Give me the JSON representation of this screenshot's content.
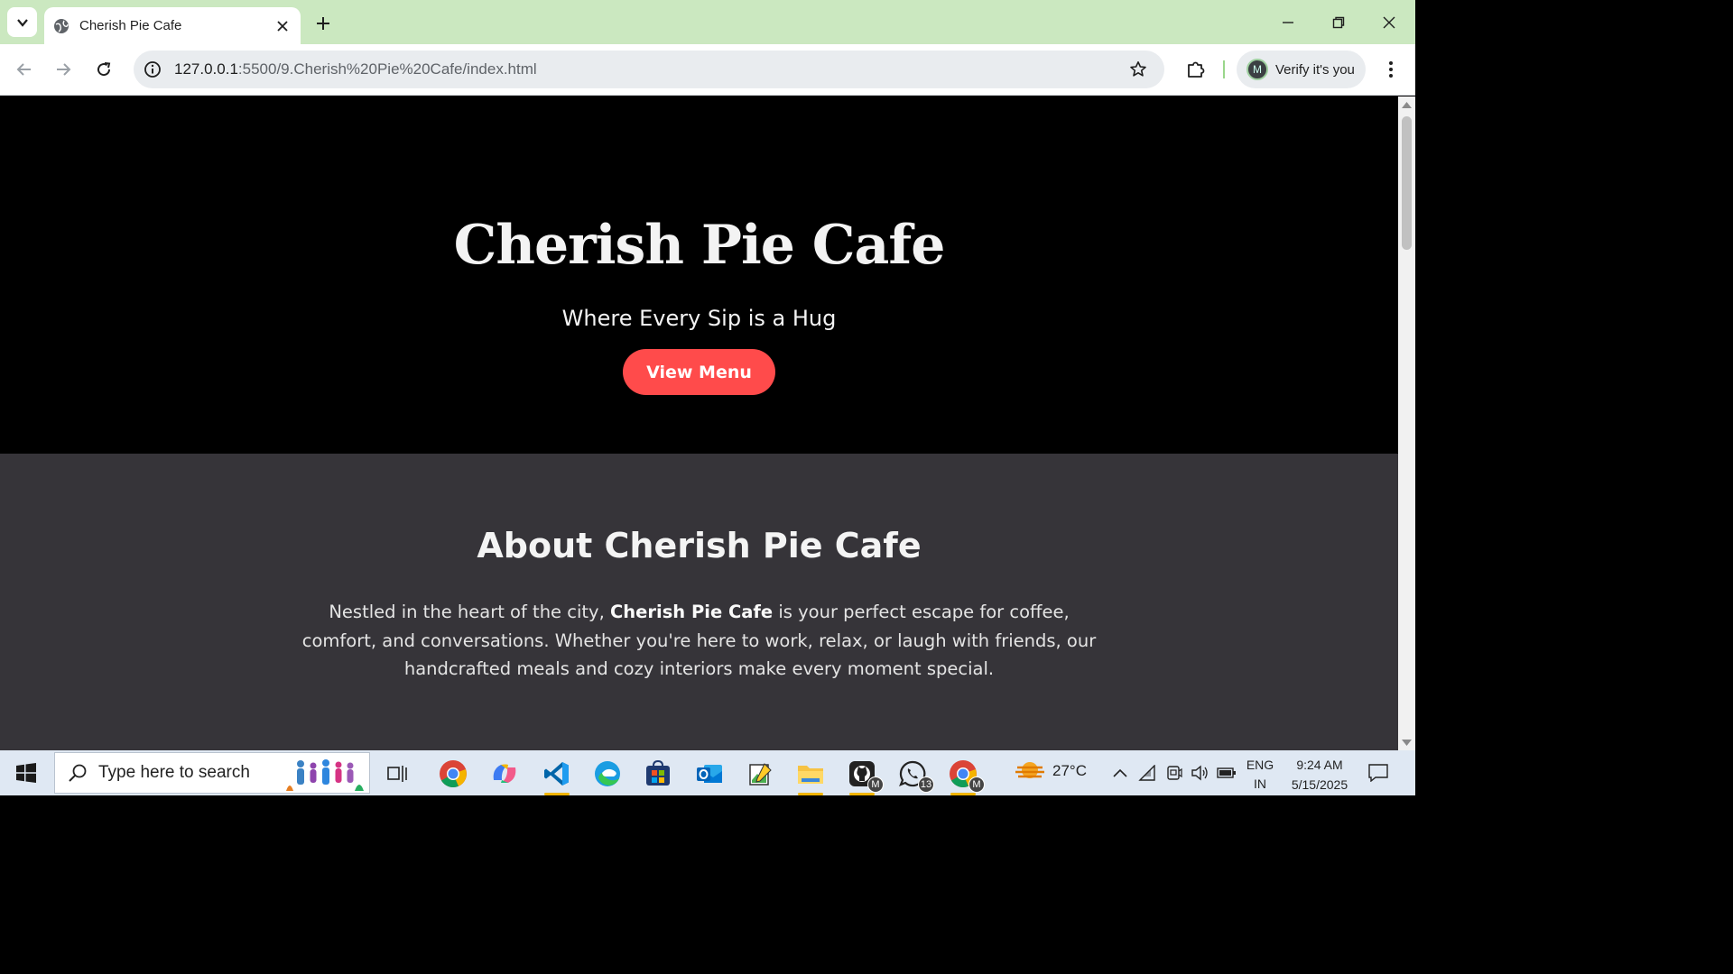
{
  "browser": {
    "tab_title": "Cherish Pie Cafe",
    "url_host": "127.0.0.1",
    "url_path": ":5500/9.Cherish%20Pie%20Cafe/index.html",
    "profile_label": "Verify it's you",
    "profile_initial": "M"
  },
  "hero": {
    "title": "Cherish Pie Cafe",
    "tagline": "Where Every Sip is a Hug",
    "cta_label": "View Menu"
  },
  "about": {
    "heading": "About Cherish Pie Cafe",
    "text_before": "Nestled in the heart of the city, ",
    "text_bold": "Cherish Pie Cafe",
    "text_after": " is your perfect escape for coffee, comfort, and conversations. Whether you're here to work, relax, or laugh with friends, our handcrafted meals and cozy interiors make every moment special."
  },
  "taskbar": {
    "search_placeholder": "Type here to search",
    "weather_temp": "27°C",
    "whatsapp_badge": "13",
    "lang_line1": "ENG",
    "lang_line2": "IN",
    "time": "9:24 AM",
    "date": "5/15/2025"
  },
  "colors": {
    "accent_button": "#ff4b4b",
    "hero_bg": "#000000",
    "about_bg": "#363439",
    "titlebar_bg": "#cbe8c0"
  }
}
